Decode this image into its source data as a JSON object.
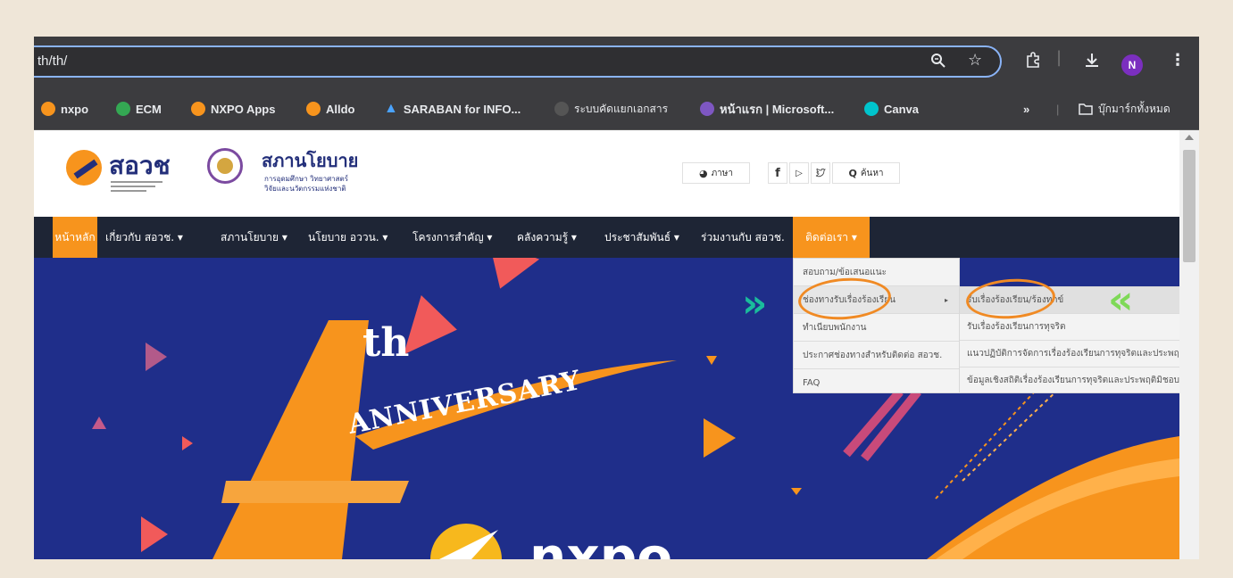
{
  "browser": {
    "url": "th/th/",
    "avatar_letter": "N",
    "icons": [
      "zoom-icon",
      "star-icon",
      "extensions-icon",
      "download-icon",
      "menu-icon"
    ]
  },
  "bookmarks": [
    {
      "label": "nxpo",
      "color": "#f7941d"
    },
    {
      "label": "ECM",
      "color": "#34a853"
    },
    {
      "label": "NXPO Apps",
      "color": "#f7941d"
    },
    {
      "label": "Alldo",
      "color": "#f7941d"
    },
    {
      "label": "SARABAN for INFO...",
      "color": "#4aa3ff"
    },
    {
      "label": "ระบบคัดแยกเอกสาร",
      "color": "#666666"
    },
    {
      "label": "หน้าแรก | Microsoft...",
      "color": "#7e57c2"
    },
    {
      "label": "Canva",
      "color": "#00c4cc"
    }
  ],
  "bookmarks_overflow": "»",
  "bookmarks_all": "บุ๊กมาร์กทั้งหมด",
  "site": {
    "logo1_text": "สอวช",
    "logo2_title": "สภานโยบาย",
    "logo2_sub1": "การอุดมศึกษา วิทยาศาสตร์",
    "logo2_sub2": "วิจัยและนวัตกรรมแห่งชาติ",
    "language_label": "ภาษา",
    "search_label": "ค้นหา"
  },
  "nav": {
    "home": "หน้าหลัก",
    "items": [
      "เกี่ยวกับ สอวช. ▾",
      "สภานโยบาย ▾",
      "นโยบาย อววน. ▾",
      "โครงการสำคัญ ▾",
      "คลังความรู้ ▾",
      "ประชาสัมพันธ์ ▾",
      "ร่วมงานกับ สอวช."
    ],
    "contact": "ติดต่อเรา ▾"
  },
  "dropdown": {
    "level1": [
      "สอบถาม/ข้อเสนอแนะ",
      "ช่องทางรับเรื่องร้องเรียน",
      "ทำเนียบพนักงาน",
      "ประกาศช่องทางสำหรับติดต่อ สอวช.",
      "FAQ"
    ],
    "submenu_arrow": "▸",
    "level2": [
      "รับเรื่องร้องเรียน/ร้องทุกข์",
      "รับเรื่องร้องเรียนการทุจริต",
      "แนวปฏิบัติการจัดการเรื่องร้องเรียนการทุจริตและประพฤติมิชอบ",
      "ข้อมูลเชิงสถิติเรื่องร้องเรียนการทุจริตและประพฤติมิชอบ"
    ]
  },
  "hero": {
    "th": "th",
    "anniversary": "ANNIVERSARY",
    "brand_partial": "nxpo"
  },
  "annotations": {
    "highlight_color": "#f08a24",
    "chevron_left_color": "#1abc9c",
    "chevron_right_color": "#7ed957"
  }
}
